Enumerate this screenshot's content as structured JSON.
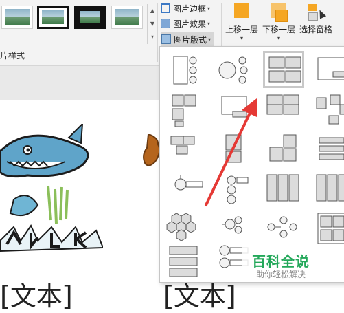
{
  "ribbon": {
    "group_label": "片样式",
    "picture_border": "图片边框",
    "picture_effects": "图片效果",
    "picture_layout": "图片版式",
    "bring_forward": "上移一层",
    "send_backward": "下移一层",
    "selection_pane": "选择窗格",
    "caret": "▾",
    "scroll_up": "▲",
    "scroll_down": "▼",
    "scroll_more": "▾"
  },
  "document": {
    "text_left": "[文本]",
    "text_right": "[文本]"
  },
  "layout_gallery": {
    "rows": 6,
    "columns": 5,
    "selected_index": 2
  },
  "watermark": {
    "title": "百科全说",
    "subtitle": "助你轻松解决"
  },
  "colors": {
    "accent_orange": "#f5a623",
    "annotation_red": "#e53935",
    "watermark_green": "#23a85a"
  }
}
